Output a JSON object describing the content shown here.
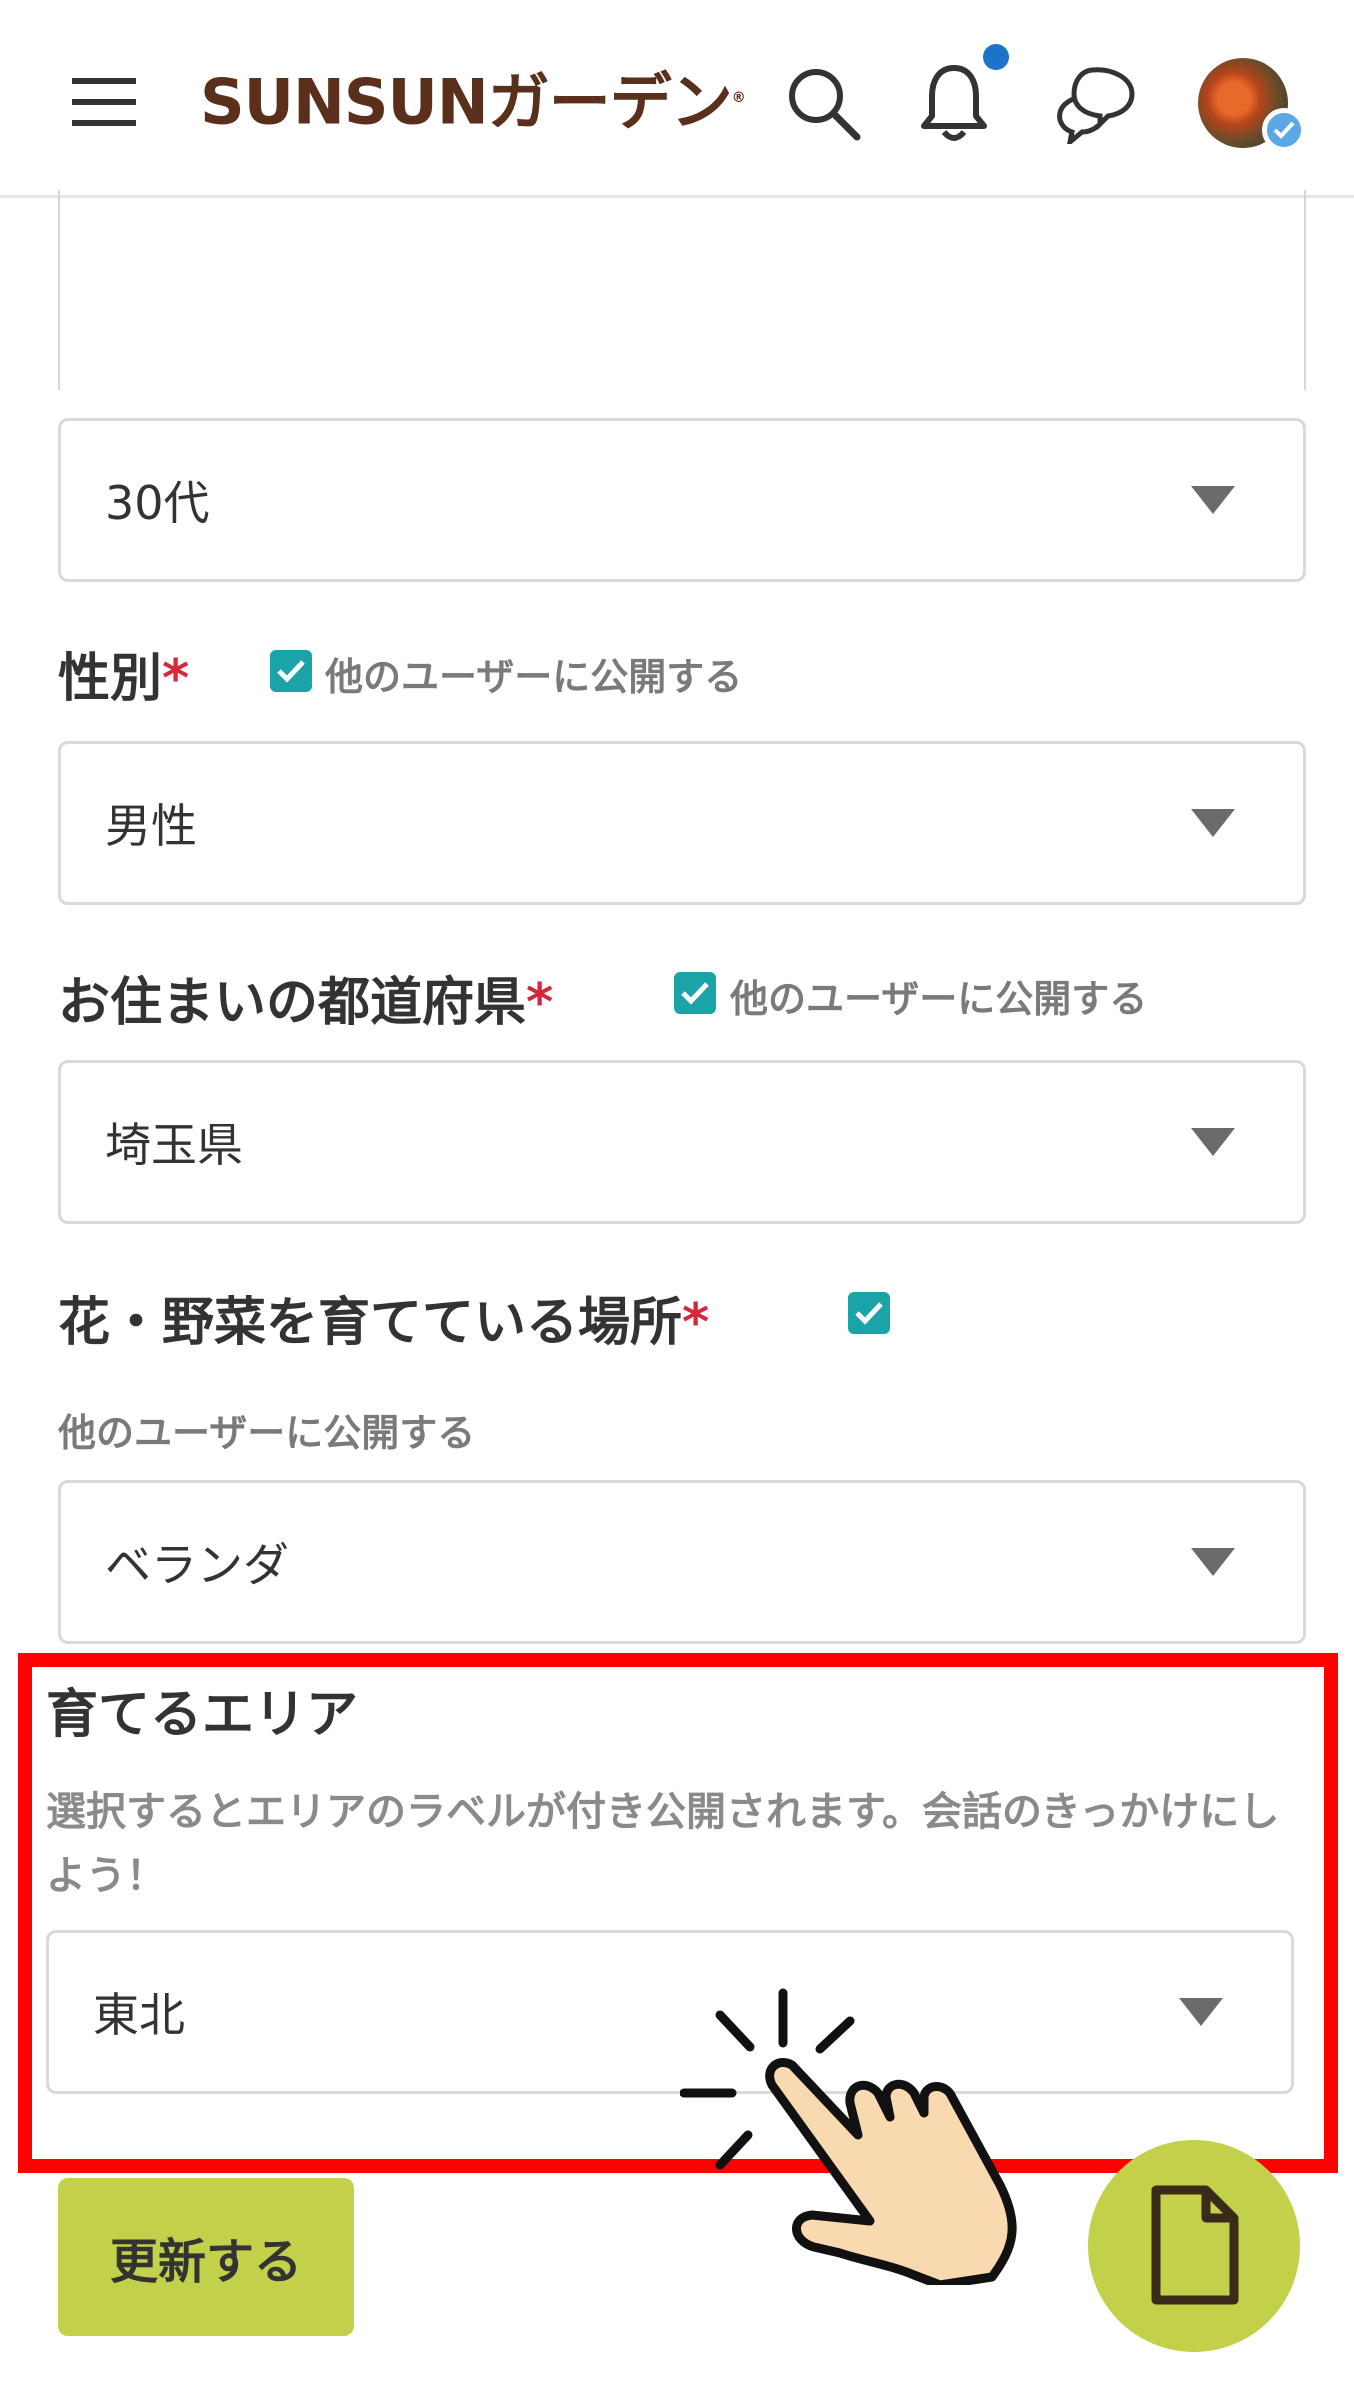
{
  "header": {
    "logo_text": "SUNSUNガーデン",
    "logo_mark": "®",
    "icons": [
      "menu-icon",
      "search-icon",
      "bell-icon",
      "chat-icon",
      "avatar"
    ],
    "notification_dot_color": "#1d73c9"
  },
  "form": {
    "age": {
      "value": "30代"
    },
    "gender": {
      "label": "性別",
      "required_mark": "*",
      "public_label": "他のユーザーに公開する",
      "public_checked": true,
      "value": "男性"
    },
    "prefecture": {
      "label": "お住まいの都道府県",
      "required_mark": "*",
      "public_label": "他のユーザーに公開する",
      "public_checked": true,
      "value": "埼玉県"
    },
    "place": {
      "label": "花・野菜を育てている場所",
      "required_mark": "*",
      "public_label": "他のユーザーに公開する",
      "public_checked": true,
      "value": "ベランダ"
    },
    "area": {
      "label": "育てるエリア",
      "help": "選択するとエリアのラベルが付き公開されます。会話のきっかけにしよう！",
      "value": "東北"
    },
    "submit_label": "更新する"
  },
  "colors": {
    "accent": "#c2d149",
    "checkbox": "#1aa3a8",
    "required": "#d6283b",
    "highlight": "#ff0000"
  }
}
